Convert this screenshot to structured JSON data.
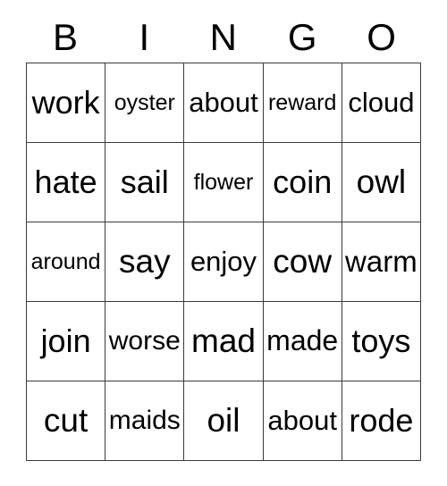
{
  "card": {
    "title": "BINGO",
    "headers": [
      "B",
      "I",
      "N",
      "G",
      "O"
    ],
    "grid_size": "5x5",
    "colors": {
      "background": "#ffffff",
      "text": "#000000",
      "border": "#3a3a3a"
    },
    "rows": [
      [
        "work",
        "oyster",
        "about",
        "reward",
        "cloud"
      ],
      [
        "hate",
        "sail",
        "flower",
        "coin",
        "owl"
      ],
      [
        "around",
        "say",
        "enjoy",
        "cow",
        "warm"
      ],
      [
        "join",
        "worse",
        "mad",
        "made",
        "toys"
      ],
      [
        "cut",
        "maids",
        "oil",
        "about",
        "rode"
      ]
    ]
  }
}
